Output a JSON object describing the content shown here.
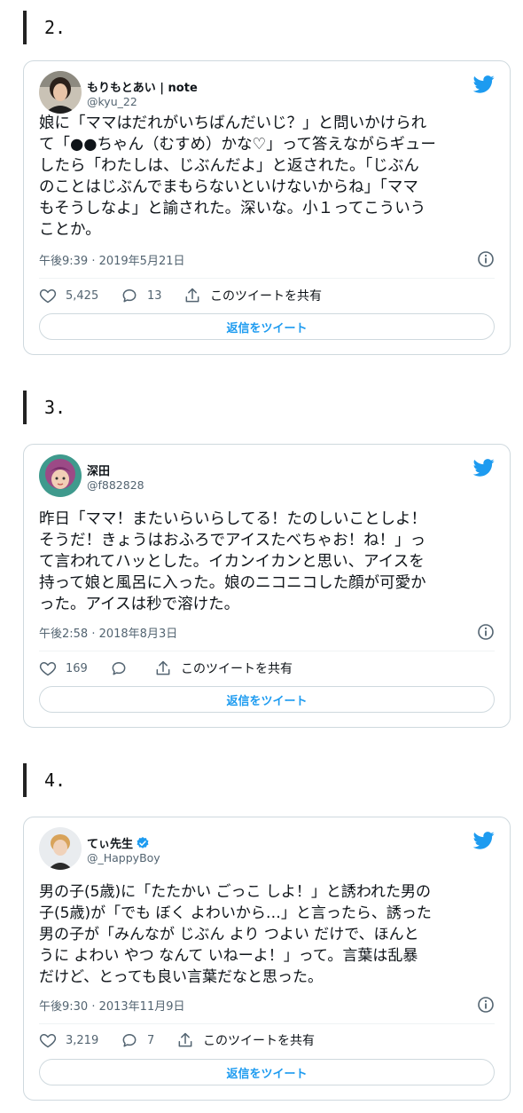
{
  "colors": {
    "accent": "#1d9bf0",
    "text": "#0f1419",
    "muted": "#536471",
    "border": "#cfd9de",
    "like": "#536471"
  },
  "sections": [
    {
      "number": "2.",
      "tweet": {
        "name": "もりもとあい | note",
        "handle": "@kyu_22",
        "verified": false,
        "text": "娘に「ママはだれがいちばんだいじ？」と問いかけられ\nて「●●ちゃん（むすめ）かな♡」って答えながらギュー\nしたら「わたしは、じぶんだよ」と返された。「じぶん\nのことはじぶんでまもらないといけないからね」「ママ\nもそうしなよ」と諭された。深いな。小１ってこういう\nことか。",
        "timestamp": "午後9:39 · 2019年5月21日",
        "likes": "5,425",
        "replies": "13",
        "share_label": "このツイートを共有",
        "reply_button": "返信をツイート",
        "avatar": "avatar-photo-woman"
      }
    },
    {
      "number": "3.",
      "tweet": {
        "name": "深田",
        "handle": "@f882828",
        "verified": false,
        "text": "昨日「ママ！またいらいらしてる！たのしいことしよ！\nそうだ！きょうはおふろでアイスたべちゃお！ね！」っ\nて言われてハッとした。イカンイカンと思い、アイスを\n持って娘と風呂に入った。娘のニコニコした顔が可愛か\nった。アイスは秒で溶けた。",
        "timestamp": "午後2:58 · 2018年8月3日",
        "likes": "169",
        "replies": "",
        "share_label": "このツイートを共有",
        "reply_button": "返信をツイート",
        "avatar": "avatar-anime-character"
      }
    },
    {
      "number": "4.",
      "tweet": {
        "name": "てぃ先生",
        "handle": "@_HappyBoy",
        "verified": true,
        "text": "男の子(5歳)に「たたかい ごっこ しよ！」と誘われた男の\n子(5歳)が「でも ぼく よわいから…」と言ったら、誘った\n男の子が「みんなが じぶん より つよい だけで、ほんと\nうに よわい やつ なんて いねーよ！」って。言葉は乱暴\nだけど、とっても良い言葉だなと思った。",
        "timestamp": "午後9:30 · 2013年11月9日",
        "likes": "3,219",
        "replies": "7",
        "share_label": "このツイートを共有",
        "reply_button": "返信をツイート",
        "avatar": "avatar-photo-man"
      }
    }
  ]
}
